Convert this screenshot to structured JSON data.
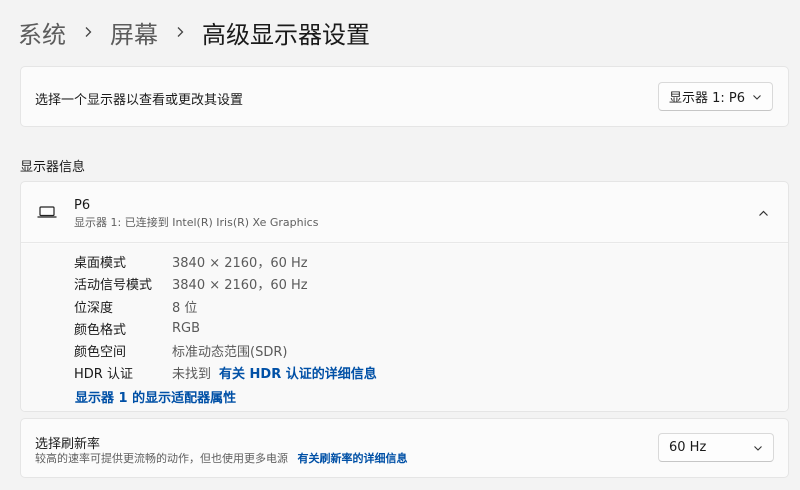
{
  "breadcrumb": {
    "items": [
      "系统",
      "屏幕"
    ],
    "current": "高级显示器设置"
  },
  "display_select": {
    "label": "选择一个显示器以查看或更改其设置",
    "value": "显示器 1: P6"
  },
  "section": {
    "title": "显示器信息"
  },
  "display_info": {
    "name": "P6",
    "subtitle": "显示器 1: 已连接到 Intel(R) Iris(R) Xe Graphics",
    "specs": [
      {
        "label": "桌面模式",
        "value": "3840 × 2160，60 Hz"
      },
      {
        "label": "活动信号模式",
        "value": "3840 × 2160，60 Hz"
      },
      {
        "label": "位深度",
        "value": "8 位"
      },
      {
        "label": "颜色格式",
        "value": "RGB"
      },
      {
        "label": "颜色空间",
        "value": "标准动态范围(SDR)"
      }
    ],
    "hdr": {
      "label": "HDR 认证",
      "value": "未找到",
      "link": "有关 HDR 认证的详细信息"
    },
    "adapter_link": "显示器 1 的显示适配器属性"
  },
  "refresh_rate": {
    "title": "选择刷新率",
    "description": "较高的速率可提供更流畅的动作，但也使用更多电源",
    "link": "有关刷新率的详细信息",
    "value": "60 Hz"
  },
  "icons": [
    "chevron-right-icon",
    "chevron-down-icon",
    "chevron-up-icon",
    "monitor-icon"
  ]
}
